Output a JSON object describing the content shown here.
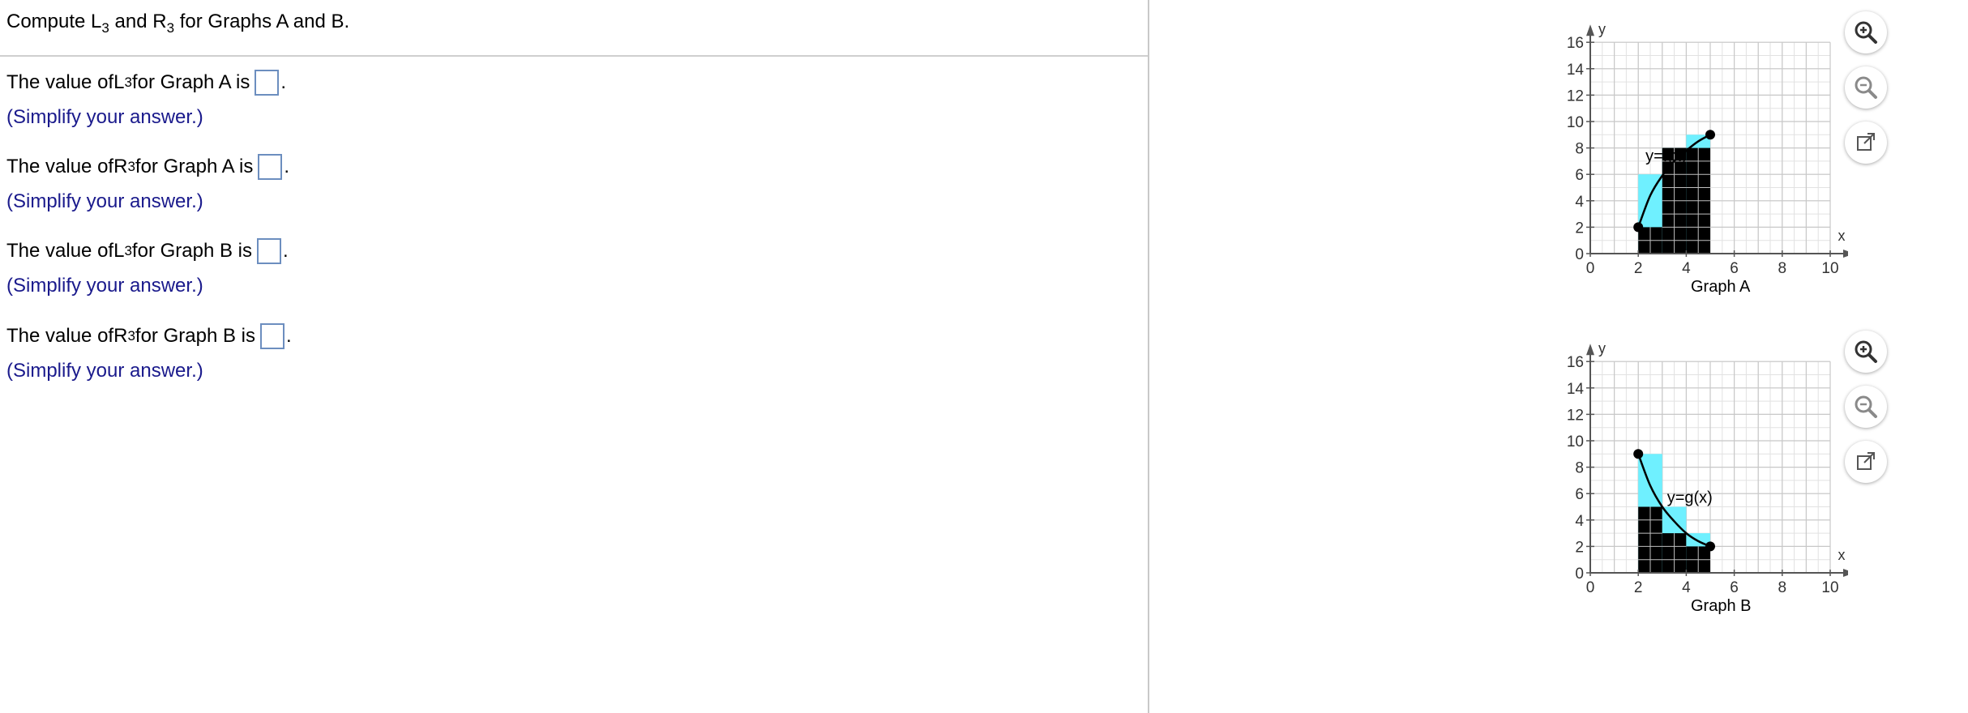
{
  "header": {
    "pre": "Compute L",
    "sub1": "3",
    "mid": " and R",
    "sub2": "3",
    "post": " for Graphs A and B."
  },
  "questions": [
    {
      "pre": "The value of ",
      "letter": "L",
      "sub": "3",
      "post": " for Graph A is",
      "hint": "(Simplify your answer.)"
    },
    {
      "pre": "The value of ",
      "letter": "R",
      "sub": "3",
      "post": " for Graph A is",
      "hint": "(Simplify your answer.)"
    },
    {
      "pre": "The value of ",
      "letter": "L",
      "sub": "3",
      "post": " for Graph B is",
      "hint": "(Simplify your answer.)"
    },
    {
      "pre": "The value of ",
      "letter": "R",
      "sub": "3",
      "post": " for Graph B is",
      "hint": "(Simplify your answer.)"
    }
  ],
  "graphs": [
    {
      "caption": "Graph A",
      "curve_label": "y=f(x)",
      "x_axis_label": "x",
      "y_axis_label": "y",
      "x_ticks": [
        "0",
        "2",
        "4",
        "6",
        "8",
        "10"
      ],
      "y_ticks": [
        "0",
        "2",
        "4",
        "6",
        "8",
        "10",
        "12",
        "14",
        "16"
      ],
      "x_range": [
        0,
        10
      ],
      "y_range": [
        0,
        16
      ],
      "intervals": [
        [
          2,
          3
        ],
        [
          3,
          4
        ],
        [
          4,
          5
        ]
      ],
      "left_heights": [
        2,
        8,
        8
      ],
      "right_heights": [
        6,
        8,
        9
      ],
      "curve_points": [
        [
          2,
          2
        ],
        [
          2.5,
          4.4
        ],
        [
          3,
          5.9
        ],
        [
          3.5,
          7.0
        ],
        [
          4,
          7.8
        ],
        [
          4.5,
          8.5
        ],
        [
          5,
          9
        ]
      ],
      "endpoints": [
        [
          2,
          2
        ],
        [
          5,
          9
        ]
      ]
    },
    {
      "caption": "Graph B",
      "curve_label": "y=g(x)",
      "x_axis_label": "x",
      "y_axis_label": "y",
      "x_ticks": [
        "0",
        "2",
        "4",
        "6",
        "8",
        "10"
      ],
      "y_ticks": [
        "0",
        "2",
        "4",
        "6",
        "8",
        "10",
        "12",
        "14",
        "16"
      ],
      "x_range": [
        0,
        10
      ],
      "y_range": [
        0,
        16
      ],
      "intervals": [
        [
          2,
          3
        ],
        [
          3,
          4
        ],
        [
          4,
          5
        ]
      ],
      "left_heights": [
        9,
        5,
        3
      ],
      "right_heights": [
        5,
        3,
        2
      ],
      "curve_points": [
        [
          2,
          9
        ],
        [
          2.5,
          6.6
        ],
        [
          3,
          5
        ],
        [
          3.5,
          3.9
        ],
        [
          4,
          3
        ],
        [
          4.5,
          2.4
        ],
        [
          5,
          2
        ]
      ],
      "endpoints": [
        [
          2,
          9
        ],
        [
          5,
          2
        ]
      ]
    }
  ],
  "colors": {
    "fill_upper": "#6ff0ff",
    "fill_lower": "#000000",
    "grid": "#c8c8c8",
    "hint": "#1a1a8c",
    "box_border": "#6c8ebf"
  },
  "icons": [
    "zoom-in-icon",
    "zoom-out-icon",
    "popout-icon"
  ]
}
